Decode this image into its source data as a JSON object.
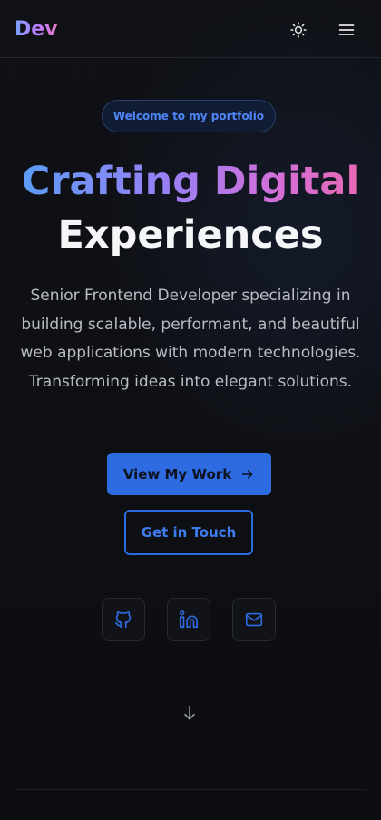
{
  "header": {
    "logo": "Dev",
    "theme_toggle_icon": "sun-icon",
    "menu_icon": "hamburger-menu-icon"
  },
  "hero": {
    "badge": "Welcome to my portfolio",
    "title_line1": "Crafting Digital",
    "title_line2": "Experiences",
    "description": "Senior Frontend Developer specializing in building scalable, performant, and beautiful web applications with modern technologies. Transforming ideas into elegant solutions.",
    "primary_button": "View My Work",
    "secondary_button": "Get in Touch"
  },
  "social": [
    {
      "icon": "github-icon"
    },
    {
      "icon": "linkedin-icon"
    },
    {
      "icon": "mail-icon"
    }
  ],
  "scroll_icon": "arrow-down-icon",
  "colors": {
    "background": "#0d0e11",
    "accent": "#2f6be0",
    "badge_text": "#4f86f7",
    "gradient_start": "#5b9cf7",
    "gradient_end": "#e86ab4"
  }
}
